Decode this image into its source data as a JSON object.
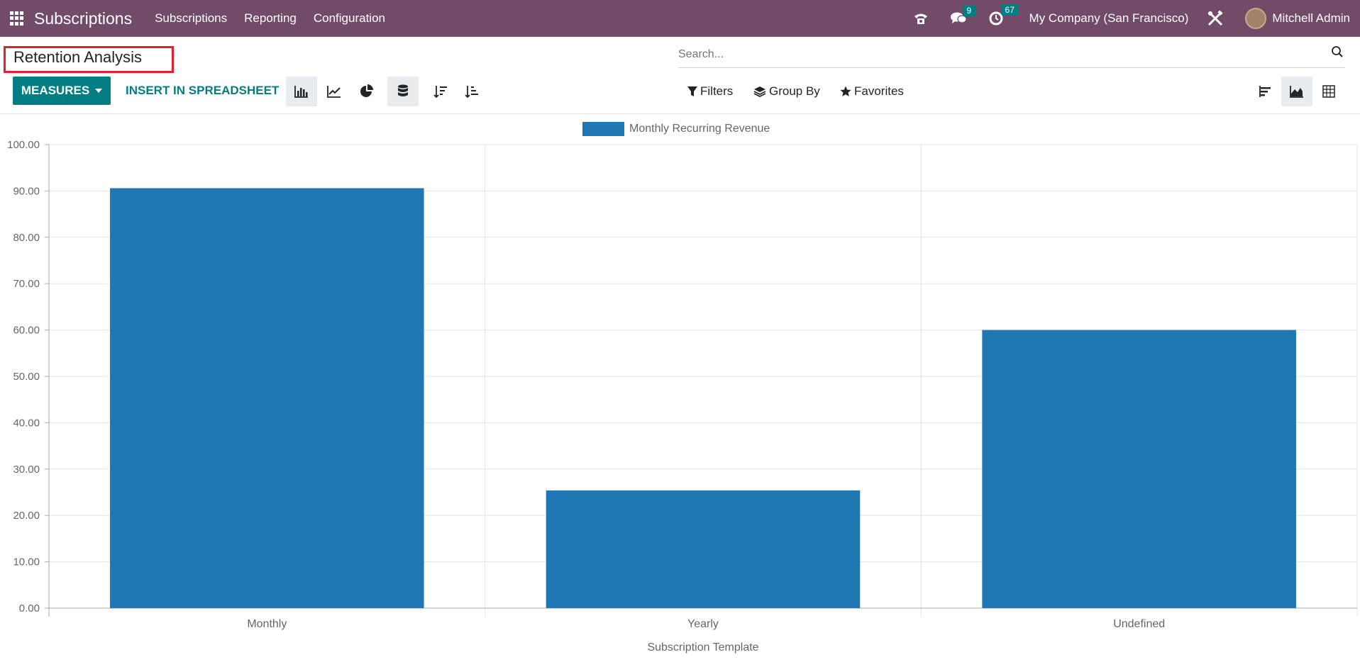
{
  "navbar": {
    "app_title": "Subscriptions",
    "menu": [
      "Subscriptions",
      "Reporting",
      "Configuration"
    ],
    "messages_count": "9",
    "activities_count": "67",
    "company": "My Company (San Francisco)",
    "user": "Mitchell Admin",
    "bg_color": "#714B67"
  },
  "page": {
    "title": "Retention Analysis",
    "search_placeholder": "Search..."
  },
  "toolbar": {
    "measures_label": "MEASURES",
    "insert_label": "INSERT IN SPREADSHEET",
    "filters_label": "Filters",
    "groupby_label": "Group By",
    "favorites_label": "Favorites",
    "accent_color": "#017E84"
  },
  "chart_data": {
    "type": "bar",
    "categories": [
      "Monthly",
      "Yearly",
      "Undefined"
    ],
    "series": [
      {
        "name": "Monthly Recurring Revenue",
        "values": [
          90.6,
          25.4,
          60.0
        ],
        "color": "#1f77b4"
      }
    ],
    "xlabel": "Subscription Template",
    "ylabel": "",
    "ylim": [
      0,
      100
    ],
    "yticks": [
      "0.00",
      "10.00",
      "20.00",
      "30.00",
      "40.00",
      "50.00",
      "60.00",
      "70.00",
      "80.00",
      "90.00",
      "100.00"
    ],
    "grid": true,
    "legend_position": "top-center"
  }
}
